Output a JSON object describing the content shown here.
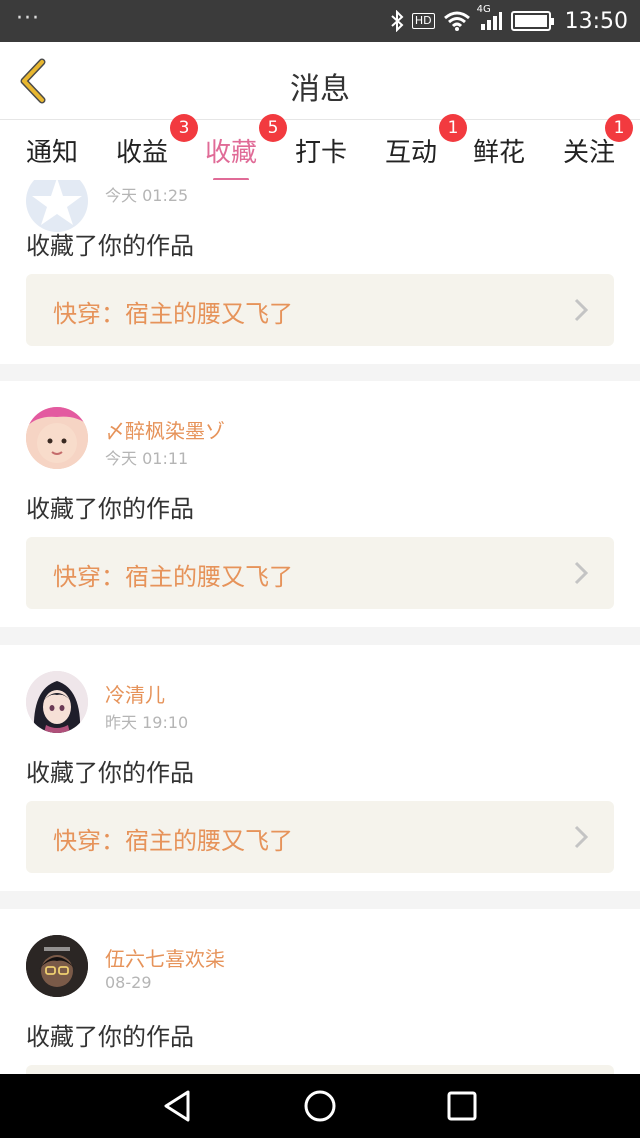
{
  "status": {
    "time": "13:50",
    "network": "4G",
    "hd": "HD",
    "dots": "···"
  },
  "header": {
    "title": "消息"
  },
  "tabs": [
    {
      "label": "通知",
      "badge": ""
    },
    {
      "label": "收益",
      "badge": "3"
    },
    {
      "label": "收藏",
      "badge": "5"
    },
    {
      "label": "打卡",
      "badge": ""
    },
    {
      "label": "互动",
      "badge": "1"
    },
    {
      "label": "鲜花",
      "badge": ""
    },
    {
      "label": "关注",
      "badge": "1"
    }
  ],
  "feed": [
    {
      "user": "",
      "time": "今天 01:25",
      "action": "收藏了你的作品",
      "work": "快穿：宿主的腰又飞了"
    },
    {
      "user": "〆醉枫染墨ゾ",
      "time": "今天 01:11",
      "action": "收藏了你的作品",
      "work": "快穿：宿主的腰又飞了"
    },
    {
      "user": "冷清儿",
      "time": "昨天 19:10",
      "action": "收藏了你的作品",
      "work": "快穿：宿主的腰又飞了"
    },
    {
      "user": "伍六七喜欢柒",
      "time": "08-29",
      "action": "收藏了你的作品",
      "work": ""
    }
  ],
  "colors": {
    "accent": "#e06b97",
    "username": "#e6935a",
    "badge": "#f23a3f",
    "back_icon": "#e8b730"
  }
}
